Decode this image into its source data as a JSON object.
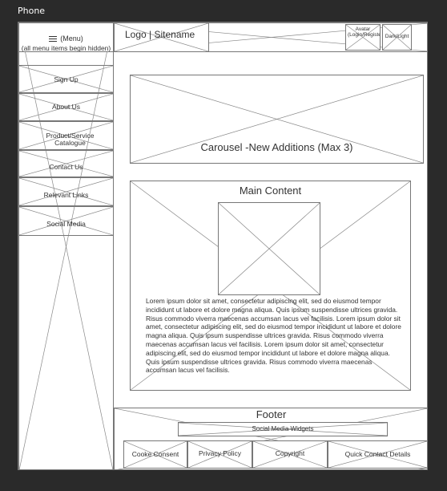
{
  "frame": {
    "title": "Phone"
  },
  "menu": {
    "label": "(Menu)",
    "note": "(all menu items begin hidden)",
    "items": [
      {
        "label": "Sign Up"
      },
      {
        "label": "About Us"
      },
      {
        "label": "Product/Service Catalogue"
      },
      {
        "label": "Contact Us"
      },
      {
        "label": "Relevant Links"
      },
      {
        "label": "Social Media"
      }
    ]
  },
  "header": {
    "logo": "Logo | Sitename",
    "avatar": "Avatar (Login/Register)",
    "dark_light": "Dark/Light"
  },
  "carousel": {
    "label": "Carousel -New Additions (Max 3)"
  },
  "main": {
    "title": "Main Content",
    "body": "Lorem ipsum dolor sit amet, consectetur adipiscing elit, sed do eiusmod tempor incididunt ut labore et dolore magna aliqua. Quis ipsum suspendisse ultrices gravida. Risus commodo viverra maecenas accumsan lacus vel facilisis. Lorem ipsum dolor sit amet, consectetur adipiscing elit, sed do eiusmod tempor incididunt ut labore et dolore magna aliqua. Quis ipsum suspendisse ultrices gravida. Risus commodo viverra maecenas accumsan lacus vel facilisis. Lorem ipsum dolor sit amet, consectetur adipiscing elit, sed do eiusmod tempor incididunt ut labore et dolore magna aliqua. Quis ipsum suspendisse ultrices gravida. Risus commodo viverra maecenas accumsan lacus vel facilisis."
  },
  "footer": {
    "title": "Footer",
    "social": "Social Media Widgets",
    "links": [
      {
        "label": "Cooke Consent"
      },
      {
        "label": "Privacy Policy"
      },
      {
        "label": "Copyright"
      },
      {
        "label": "Quick Contact Details"
      }
    ]
  },
  "colors": {
    "background": "#2a2a2a",
    "canvas": "#ffffff",
    "stroke": "#777777",
    "text": "#333333"
  }
}
